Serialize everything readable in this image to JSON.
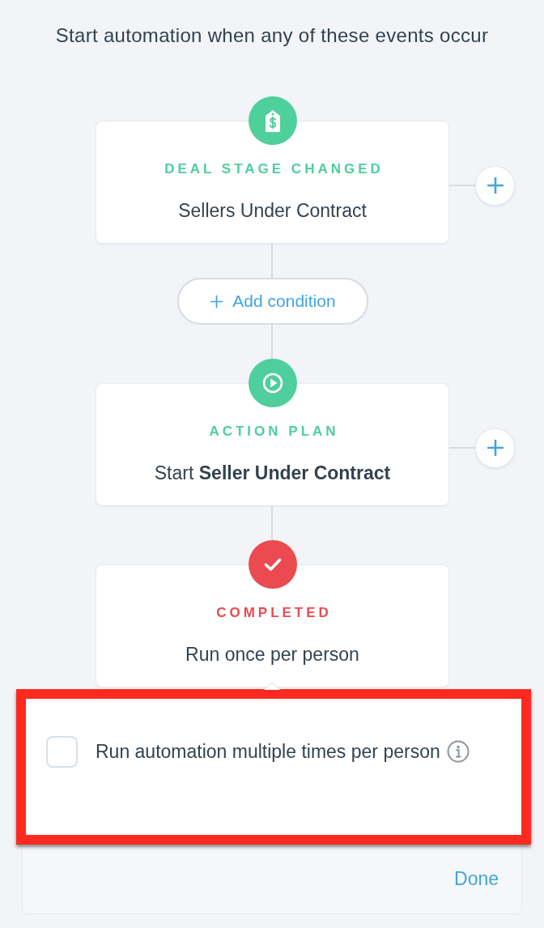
{
  "heading": "Start automation when any of these events occur",
  "flow": [
    {
      "kind": "trigger",
      "color": "#4ecf9c",
      "title": "DEAL STAGE CHANGED",
      "text": "Sellers Under Contract",
      "addable": true
    },
    {
      "kind": "condition",
      "label": "Add condition"
    },
    {
      "kind": "action",
      "color": "#4ecf9c",
      "title": "ACTION PLAN",
      "text": "Start **Seller Under Contract**",
      "addable": true
    },
    {
      "kind": "exit",
      "color": "#eb4a50",
      "title": "COMPLETED",
      "text": "Run once per person",
      "addable": false
    }
  ],
  "popover": {
    "option": {
      "label": "Run automation multiple times per person",
      "checked": false,
      "highlighted": true
    },
    "done": "Done"
  }
}
